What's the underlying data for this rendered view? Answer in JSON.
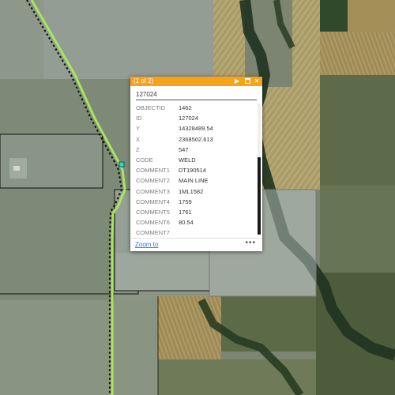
{
  "popup": {
    "count_label": "(1 of 2)",
    "title": "127024",
    "attributes": [
      {
        "key": "OBJECTID",
        "value": "1462"
      },
      {
        "key": "ID",
        "value": "127024"
      },
      {
        "key": "Y",
        "value": "14328489.54"
      },
      {
        "key": "X",
        "value": "2368502.613"
      },
      {
        "key": "Z",
        "value": "547"
      },
      {
        "key": "CODE",
        "value": "WELD"
      },
      {
        "key": "COMMENT1",
        "value": "DT190514"
      },
      {
        "key": "COMMENT2",
        "value": "MAIN LINE"
      },
      {
        "key": "COMMENT3",
        "value": "1ML1582"
      },
      {
        "key": "COMMENT4",
        "value": "1759"
      },
      {
        "key": "COMMENT5",
        "value": "1761"
      },
      {
        "key": "COMMENT6",
        "value": "80.54"
      },
      {
        "key": "COMMENT7",
        "value": ""
      },
      {
        "key": "COMMENT8",
        "value": ""
      }
    ],
    "zoom_label": "Zoom to",
    "more_label": "•••",
    "icons": {
      "next": "play-icon",
      "maximize": "maximize-icon",
      "close": "close-icon"
    },
    "accent_color": "#f7a21b"
  },
  "map": {
    "basemap": "satellite imagery",
    "pipeline_color": "#a8e65a",
    "parcel_outline_color": "#111111"
  }
}
